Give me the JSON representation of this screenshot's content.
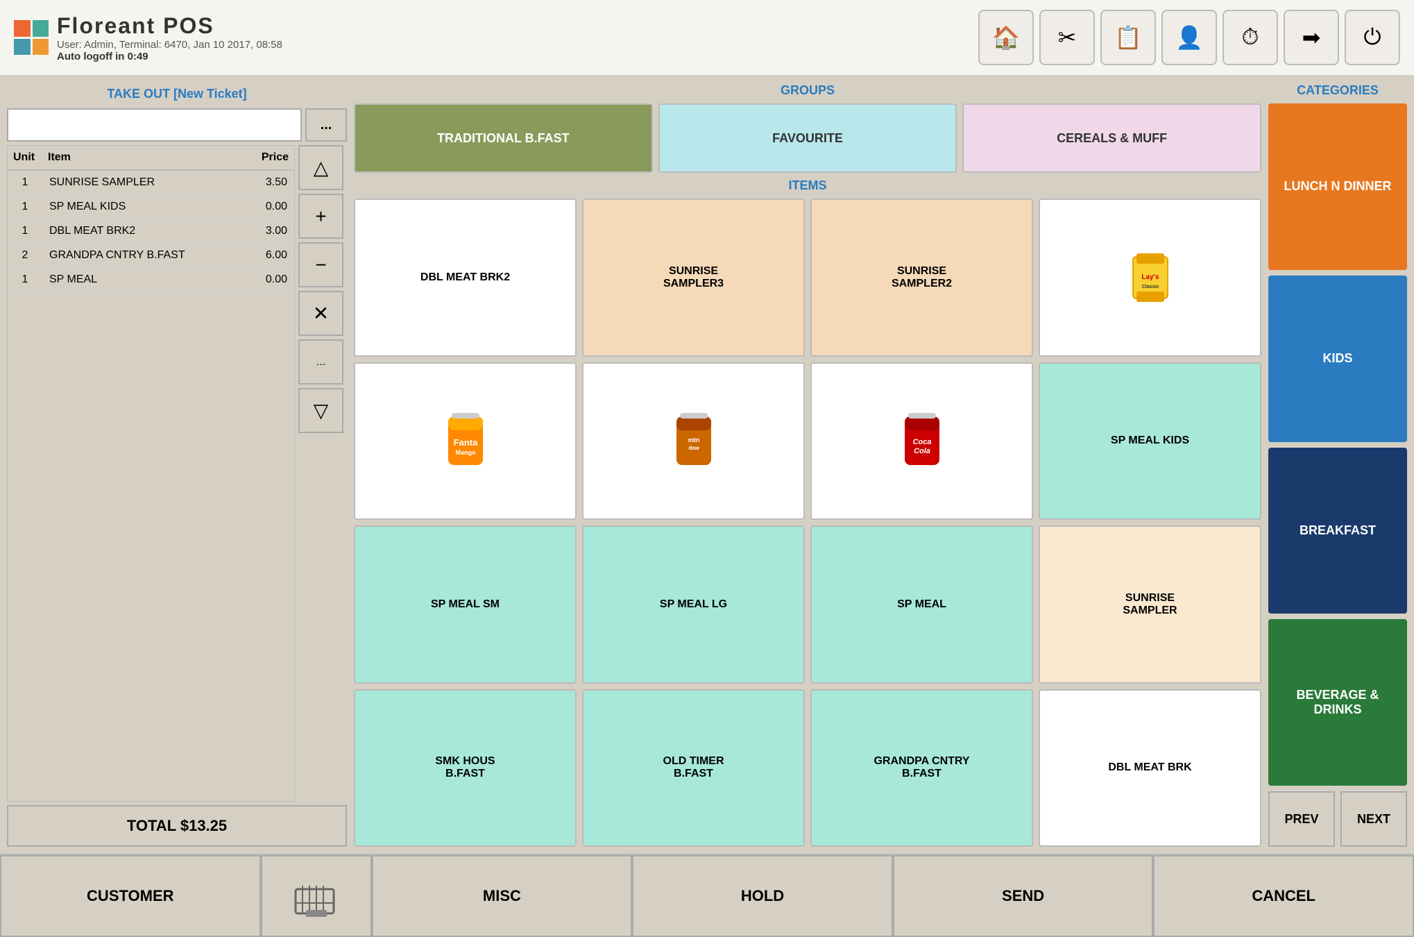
{
  "header": {
    "logo_title": "Floreant POS",
    "user_info": "User: Admin, Terminal: 6470, Jan 10 2017, 08:58",
    "auto_logoff": "Auto logoff in 0:49"
  },
  "top_buttons": [
    {
      "name": "home-button",
      "icon": "🏠"
    },
    {
      "name": "tools-button",
      "icon": "🔧"
    },
    {
      "name": "reports-button",
      "icon": "📋"
    },
    {
      "name": "admin-button",
      "icon": "👤"
    },
    {
      "name": "clock-button",
      "icon": "⏱"
    },
    {
      "name": "exit-button",
      "icon": "➡"
    },
    {
      "name": "power-button",
      "icon": "⏻"
    }
  ],
  "ticket": {
    "header": "TAKE OUT [New Ticket]",
    "input_placeholder": "",
    "dots_label": "...",
    "columns": [
      "Unit",
      "Item",
      "Price"
    ],
    "rows": [
      {
        "unit": "1",
        "item": "SUNRISE SAMPLER",
        "price": "3.50"
      },
      {
        "unit": "1",
        "item": "SP MEAL KIDS",
        "price": "0.00"
      },
      {
        "unit": "1",
        "item": "DBL MEAT BRK2",
        "price": "3.00"
      },
      {
        "unit": "2",
        "item": "GRANDPA CNTRY B.FAST",
        "price": "6.00"
      },
      {
        "unit": "1",
        "item": "SP MEAL",
        "price": "0.00"
      }
    ],
    "total_label": "TOTAL $13.25"
  },
  "controls": [
    {
      "name": "up-arrow",
      "symbol": "△"
    },
    {
      "name": "plus",
      "symbol": "+"
    },
    {
      "name": "minus",
      "symbol": "−"
    },
    {
      "name": "delete",
      "symbol": "×"
    },
    {
      "name": "more",
      "symbol": "..."
    },
    {
      "name": "down-arrow",
      "symbol": "▽"
    }
  ],
  "groups": {
    "header": "GROUPS",
    "items": [
      {
        "label": "TRADITIONAL B.FAST",
        "style": "active"
      },
      {
        "label": "FAVOURITE",
        "style": "light-blue"
      },
      {
        "label": "CEREALS & MUFF",
        "style": "light-pink"
      }
    ]
  },
  "items": {
    "header": "ITEMS",
    "grid": [
      {
        "label": "DBL MEAT BRK2",
        "style": "white",
        "has_image": false
      },
      {
        "label": "SUNRISE SAMPLER3",
        "style": "peach",
        "has_image": false
      },
      {
        "label": "SUNRISE SAMPLER2",
        "style": "peach",
        "has_image": false
      },
      {
        "label": "CHIPS",
        "style": "white",
        "has_image": true,
        "image_type": "chips"
      },
      {
        "label": "",
        "style": "white",
        "has_image": true,
        "image_type": "fanta"
      },
      {
        "label": "",
        "style": "white",
        "has_image": true,
        "image_type": "mtn"
      },
      {
        "label": "",
        "style": "white",
        "has_image": true,
        "image_type": "cola"
      },
      {
        "label": "SP MEAL KIDS",
        "style": "teal",
        "has_image": false
      },
      {
        "label": "SP MEAL SM",
        "style": "teal",
        "has_image": false
      },
      {
        "label": "SP MEAL LG",
        "style": "teal",
        "has_image": false
      },
      {
        "label": "SP MEAL",
        "style": "teal",
        "has_image": false
      },
      {
        "label": "SUNRISE SAMPLER",
        "style": "light-peach",
        "has_image": false
      },
      {
        "label": "SMK HOUS B.FAST",
        "style": "teal",
        "has_image": false
      },
      {
        "label": "OLD TIMER B.FAST",
        "style": "teal",
        "has_image": false
      },
      {
        "label": "GRANDPA CNTRY B.FAST",
        "style": "teal",
        "has_image": false
      },
      {
        "label": "DBL MEAT BRK",
        "style": "white",
        "has_image": false
      }
    ]
  },
  "categories": {
    "header": "CATEGORIES",
    "items": [
      {
        "label": "LUNCH N DINNER",
        "style": "orange"
      },
      {
        "label": "KIDS",
        "style": "blue"
      },
      {
        "label": "BREAKFAST",
        "style": "dark-blue"
      },
      {
        "label": "BEVERAGE & DRINKS",
        "style": "green"
      }
    ],
    "prev_label": "PREV",
    "next_label": "NEXT"
  },
  "bottom_bar": {
    "customer_label": "CUSTOMER",
    "misc_label": "MISC",
    "hold_label": "HOLD",
    "send_label": "SEND",
    "cancel_label": "CANCEL"
  }
}
